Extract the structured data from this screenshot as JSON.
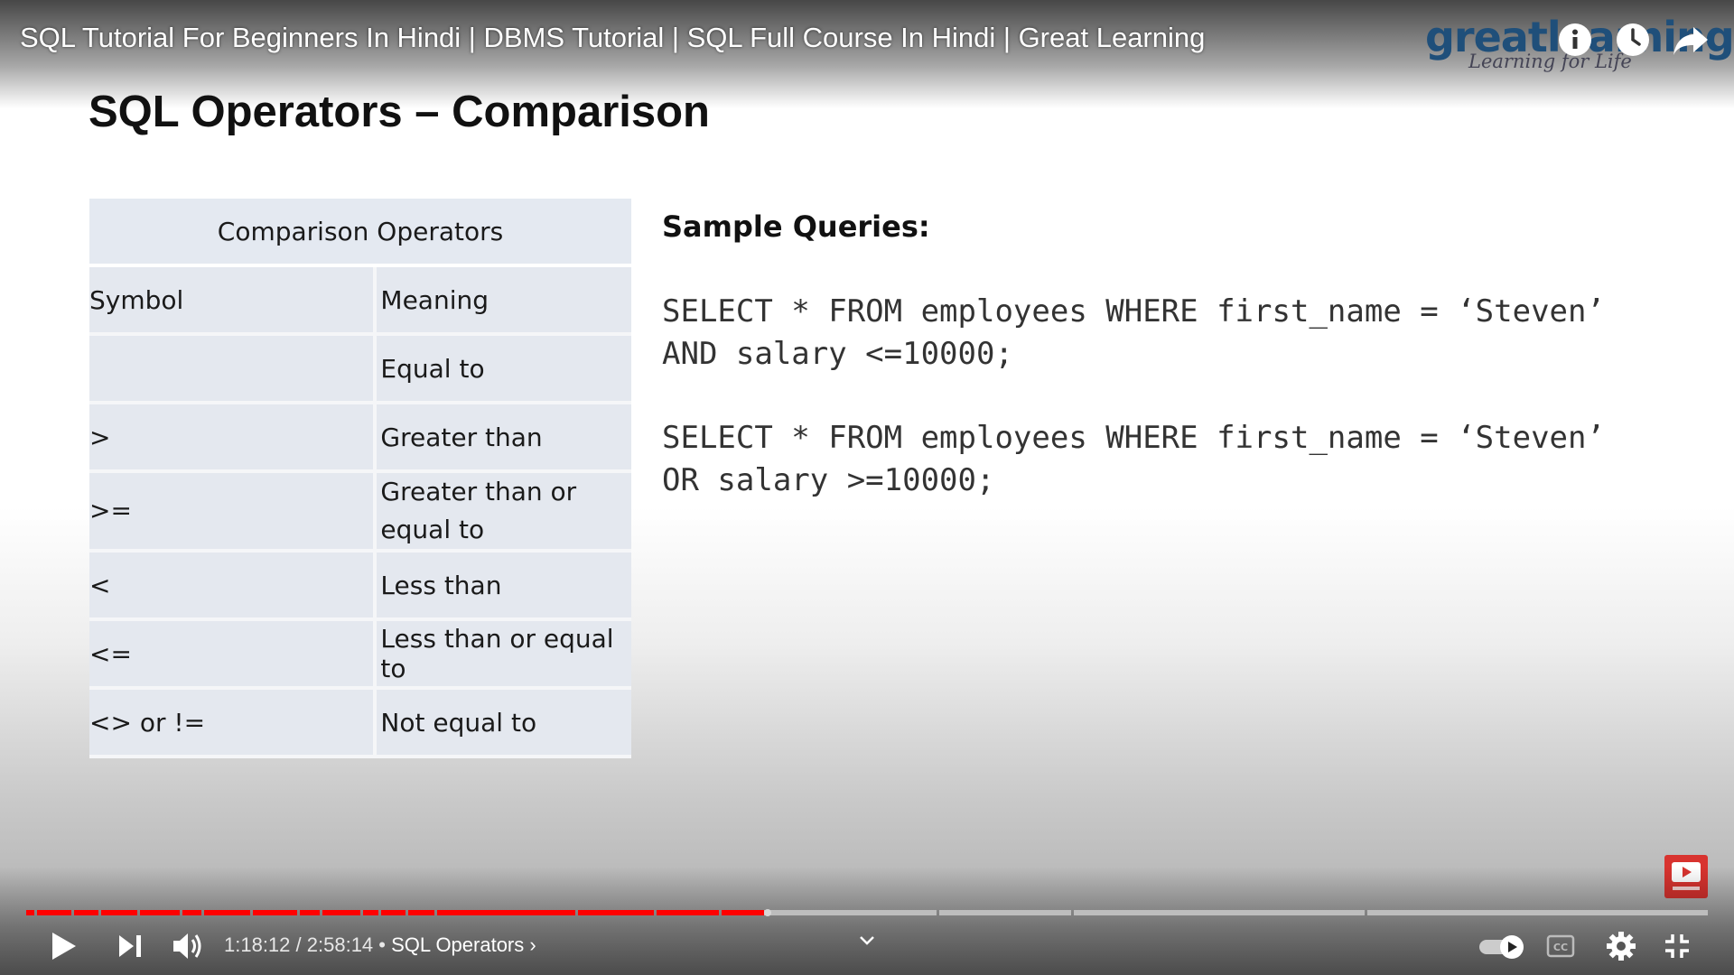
{
  "video": {
    "title": "SQL Tutorial For Beginners In Hindi | DBMS Tutorial | SQL Full Course In Hindi | Great Learning"
  },
  "brand": {
    "logo_word": "greatlearning",
    "logo_tagline": "Learning for Life",
    "color": "#1f4f7a"
  },
  "slide": {
    "title": "SQL Operators – Comparison",
    "table": {
      "caption": "Comparison Operators",
      "columns": [
        "Symbol",
        "Meaning"
      ],
      "rows": [
        {
          "symbol": "",
          "meaning": "Equal to"
        },
        {
          "symbol": ">",
          "meaning": "Greater than"
        },
        {
          "symbol": ">=",
          "meaning": "Greater than or equal to"
        },
        {
          "symbol": "<",
          "meaning": "Less than"
        },
        {
          "symbol": "<=",
          "meaning": "Less than or equal to"
        },
        {
          "symbol": "<> or !=",
          "meaning": "Not equal to"
        }
      ]
    },
    "sample_heading": "Sample Queries:",
    "queries": [
      {
        "line1": "SELECT * FROM employees WHERE first_name = ‘Steven’",
        "line2": "AND salary <=10000;"
      },
      {
        "line1": "SELECT * FROM employees WHERE first_name = ‘Steven’",
        "line2": "OR salary >=10000;"
      }
    ]
  },
  "player": {
    "current_time": "1:18:12",
    "duration": "2:58:14",
    "separator": "•",
    "chapter": "SQL Operators",
    "progress_fraction": 0.439,
    "buttons": {
      "play": "play-icon",
      "next": "next-icon",
      "volume": "volume-icon",
      "autoplay": "autoplay-toggle-icon",
      "captions": "cc-icon",
      "settings": "gear-icon",
      "exit_fullscreen": "exit-fullscreen-icon",
      "info": "info-icon",
      "watch_later": "clock-icon",
      "share": "share-icon",
      "subscribe": "subscribe-icon"
    },
    "colors": {
      "played": "#ff0000",
      "unplayed": "#bdbdbd",
      "buffered": "#d6d6d6"
    }
  }
}
